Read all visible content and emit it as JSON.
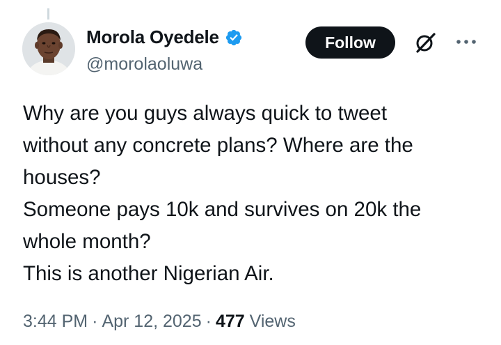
{
  "author": {
    "display_name": "Morola Oyedele",
    "handle": "@morolaoluwa",
    "verified": true
  },
  "actions": {
    "follow_label": "Follow",
    "grok_icon": "grok-icon",
    "more_icon": "more-horizontal-icon"
  },
  "tweet": {
    "lines": [
      "Why are you guys always quick to tweet",
      "without any concrete plans? Where are the",
      "houses?",
      "Someone pays 10k and survives on 20k the",
      "whole month?",
      "This is another Nigerian Air."
    ]
  },
  "meta": {
    "time": "3:44 PM",
    "separator": "·",
    "date": "Apr 12, 2025",
    "views_count": "477",
    "views_label": "Views"
  },
  "colors": {
    "text": "#0f1419",
    "secondary": "#536471",
    "verified_blue": "#1d9bf0",
    "button_bg": "#0f1419"
  }
}
